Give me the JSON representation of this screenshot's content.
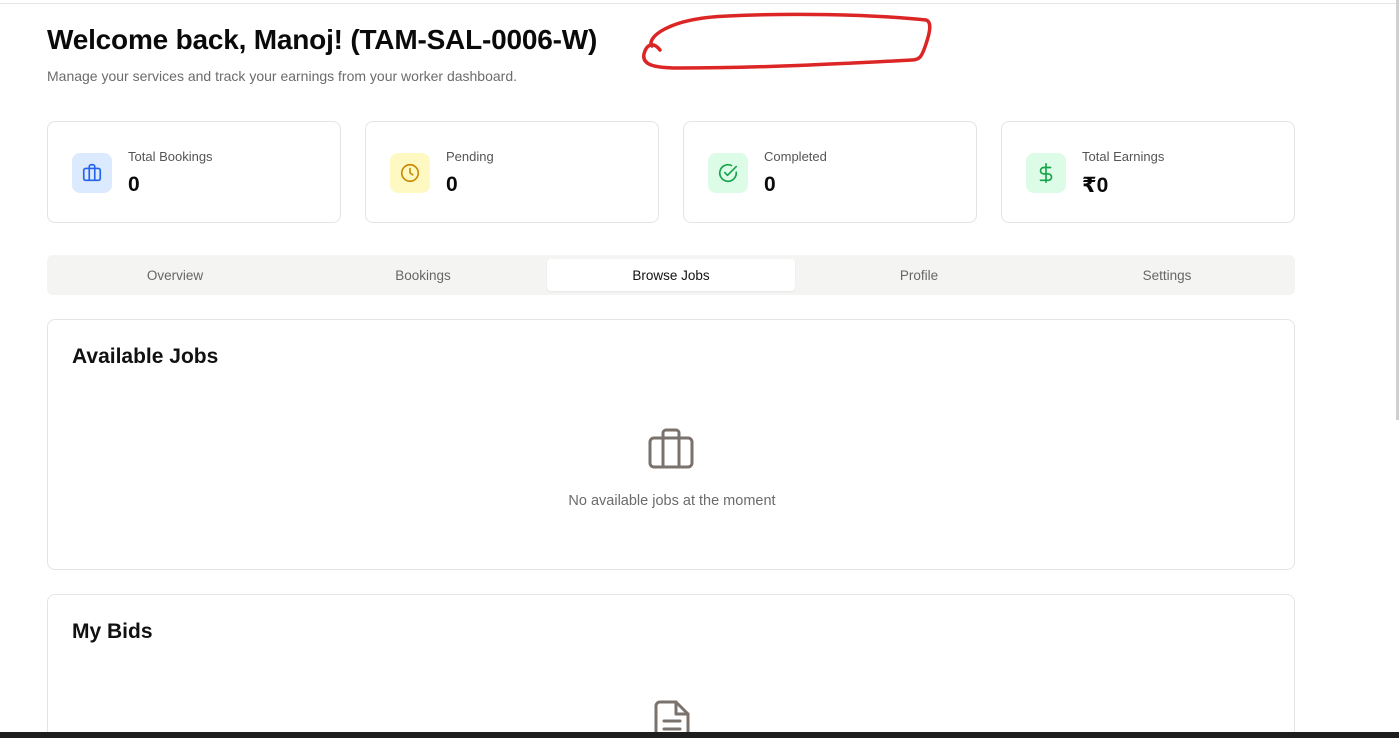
{
  "header": {
    "title": "Welcome back, Manoj! (TAM-SAL-0006-W)",
    "subtitle": "Manage your services and track your earnings from your worker dashboard."
  },
  "stats": [
    {
      "label": "Total Bookings",
      "value": "0",
      "icon": "briefcase-icon",
      "icon_color": "#2563eb",
      "icon_bg": "#dbeafe"
    },
    {
      "label": "Pending",
      "value": "0",
      "icon": "clock-icon",
      "icon_color": "#ca8a04",
      "icon_bg": "#fef9c3"
    },
    {
      "label": "Completed",
      "value": "0",
      "icon": "check-circle-icon",
      "icon_color": "#16a34a",
      "icon_bg": "#dcfce7"
    },
    {
      "label": "Total Earnings",
      "value": "₹0",
      "icon": "dollar-icon",
      "icon_color": "#16a34a",
      "icon_bg": "#dcfce7"
    }
  ],
  "tabs": [
    {
      "label": "Overview",
      "active": false
    },
    {
      "label": "Bookings",
      "active": false
    },
    {
      "label": "Browse Jobs",
      "active": true
    },
    {
      "label": "Profile",
      "active": false
    },
    {
      "label": "Settings",
      "active": false
    }
  ],
  "available_jobs": {
    "title": "Available Jobs",
    "empty_message": "No available jobs at the moment",
    "icon": "briefcase-icon"
  },
  "my_bids": {
    "title": "My Bids",
    "icon": "document-icon"
  },
  "annotation": {
    "color": "#dc2626"
  }
}
